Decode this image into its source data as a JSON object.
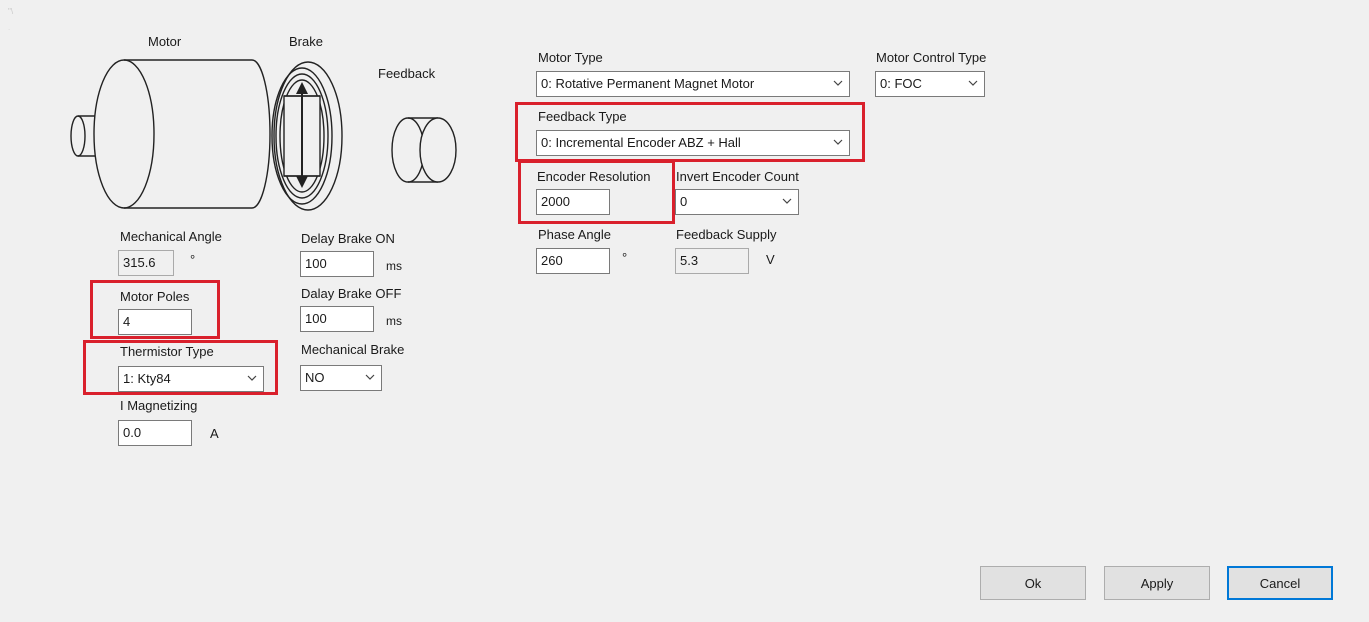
{
  "diagram": {
    "motor_label": "Motor",
    "brake_label": "Brake",
    "feedback_label": "Feedback"
  },
  "left": {
    "mechanical_angle": {
      "label": "Mechanical Angle",
      "value": "315.6",
      "unit": "°"
    },
    "motor_poles": {
      "label": "Motor Poles",
      "value": "4"
    },
    "thermistor_type": {
      "label": "Thermistor Type",
      "value": "1: Kty84"
    },
    "i_magnetizing": {
      "label": "I Magnetizing",
      "value": "0.0",
      "unit": "A"
    }
  },
  "brake": {
    "delay_on": {
      "label": "Delay Brake ON",
      "value": "100",
      "unit": "ms"
    },
    "delay_off": {
      "label": "Dalay Brake OFF",
      "value": "100",
      "unit": "ms"
    },
    "mechanical_brake": {
      "label": "Mechanical Brake",
      "value": "NO"
    }
  },
  "right": {
    "motor_type": {
      "label": "Motor Type",
      "value": "0: Rotative Permanent Magnet Motor"
    },
    "motor_control_type": {
      "label": "Motor Control Type",
      "value": "0: FOC"
    },
    "feedback_type": {
      "label": "Feedback Type",
      "value": "0: Incremental Encoder ABZ + Hall"
    },
    "encoder_resolution": {
      "label": "Encoder Resolution",
      "value": "2000"
    },
    "invert_encoder_count": {
      "label": "Invert Encoder Count",
      "value": "0"
    },
    "phase_angle": {
      "label": "Phase Angle",
      "value": "260",
      "unit": "°"
    },
    "feedback_supply": {
      "label": "Feedback Supply",
      "value": "5.3",
      "unit": "V"
    }
  },
  "buttons": {
    "ok": "Ok",
    "apply": "Apply",
    "cancel": "Cancel"
  },
  "colors": {
    "highlight": "#d9202c",
    "default_button_border": "#0078d7",
    "background": "#f0f0f0"
  },
  "icons": {
    "dropdown": "chevron-down-icon",
    "window": "app-icon"
  }
}
